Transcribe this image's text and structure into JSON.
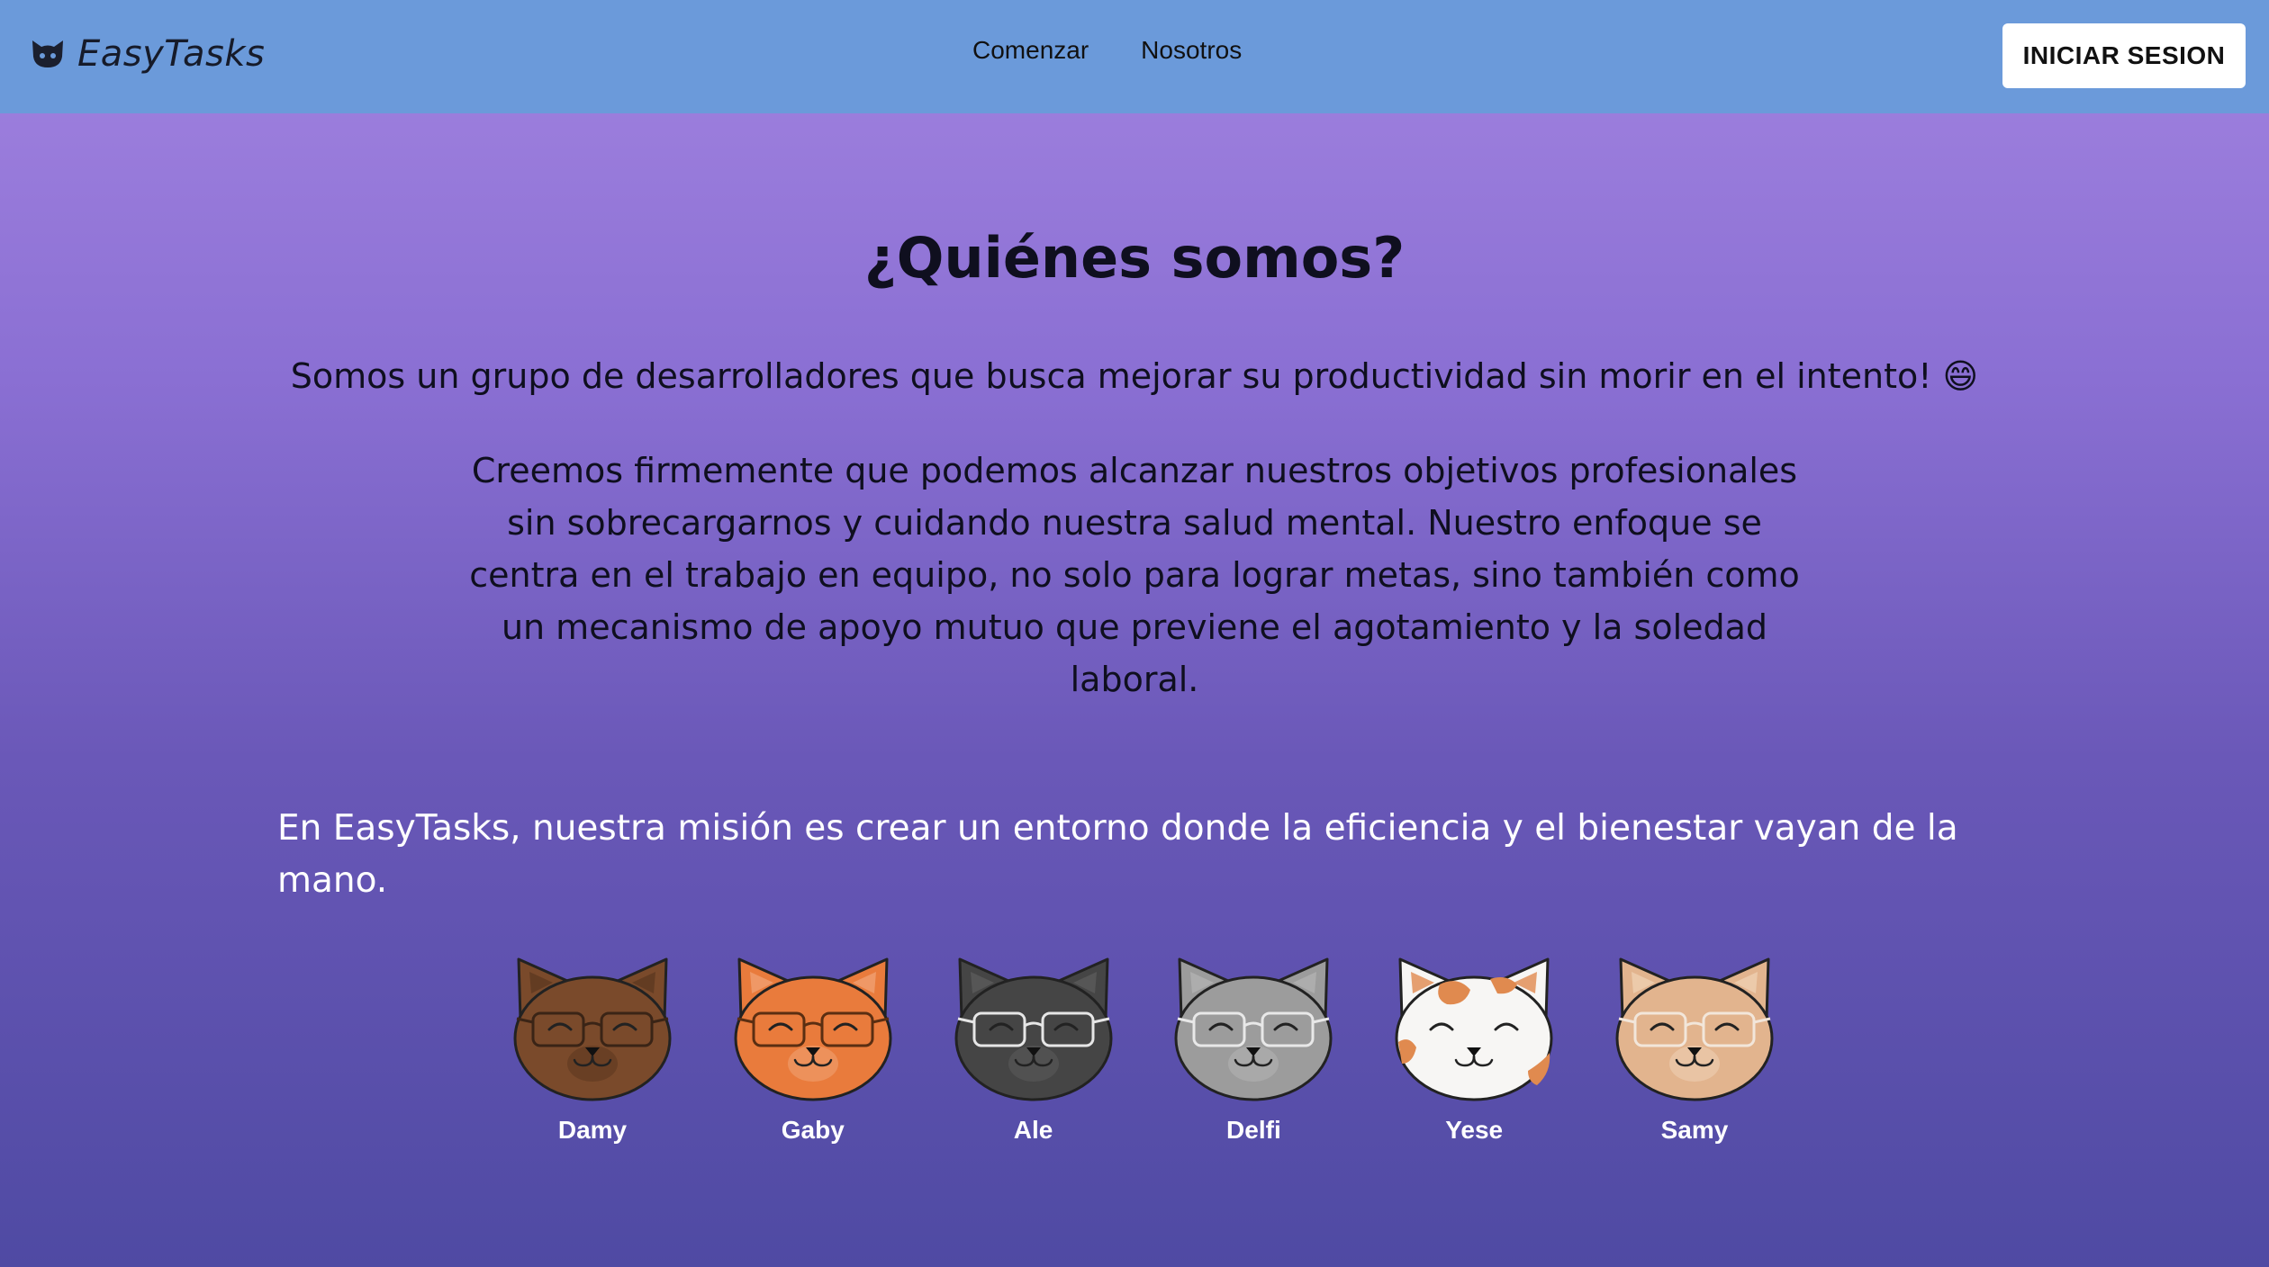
{
  "brand": {
    "name": "EasyTasks",
    "logo_icon": "cat-face-icon"
  },
  "nav": {
    "links": [
      {
        "label": "Comenzar"
      },
      {
        "label": "Nosotros"
      }
    ]
  },
  "login": {
    "label": "INICIAR SESION"
  },
  "about": {
    "title": "¿Quiénes somos?",
    "intro": "Somos un grupo de desarrolladores que busca mejorar su productividad sin morir en el intento! 😄",
    "body": "Creemos firmemente que podemos alcanzar nuestros objetivos profesionales sin sobrecargarnos y cuidando nuestra salud mental. Nuestro enfoque se centra en el trabajo en equipo, no solo para lograr metas, sino también como un mecanismo de apoyo mutuo que previene el agotamiento y la soledad laboral.",
    "mission": "En EasyTasks, nuestra misión es crear un entorno donde la eficiencia y el bienestar vayan de la mano."
  },
  "team": [
    {
      "name": "Damy",
      "fur": "#7a4a2b",
      "accent": "#5e3820",
      "glasses": "#3a2416",
      "spots": false
    },
    {
      "name": "Gaby",
      "fur": "#e97b3c",
      "accent": "#f0a070",
      "glasses": "#5a2e12",
      "spots": false
    },
    {
      "name": "Ale",
      "fur": "#454545",
      "accent": "#5a5a5a",
      "glasses": "#e6e6e6",
      "spots": false
    },
    {
      "name": "Delfi",
      "fur": "#9c9c9c",
      "accent": "#b2b2b2",
      "glasses": "#e8e8e8",
      "spots": false
    },
    {
      "name": "Yese",
      "fur": "#f7f6f4",
      "accent": "#e08a4f",
      "glasses": "none",
      "spots": true
    },
    {
      "name": "Samy",
      "fur": "#e2b48e",
      "accent": "#efcfb2",
      "glasses": "#f2e6da",
      "spots": false
    }
  ],
  "colors": {
    "navbar": "#6b9ada",
    "gradient_top": "#a283e0",
    "gradient_bottom": "#4f4aa3"
  }
}
